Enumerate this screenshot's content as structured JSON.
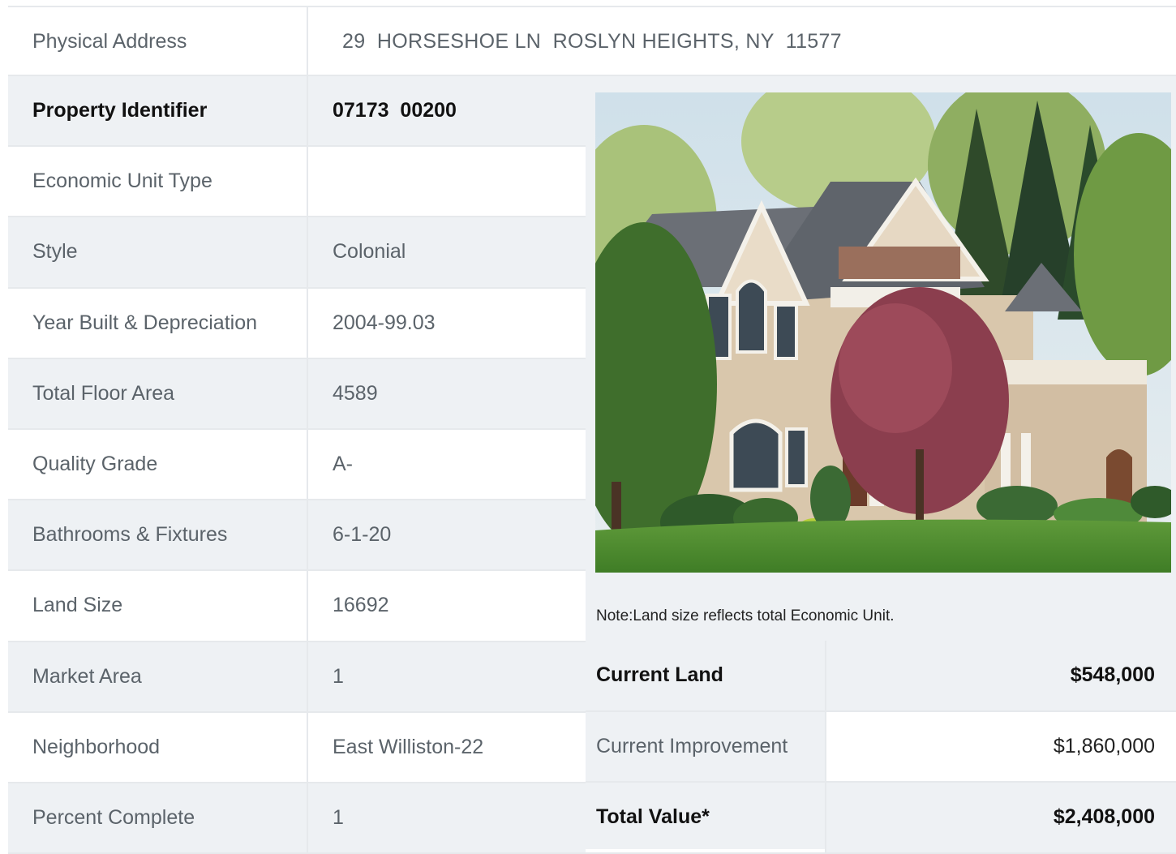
{
  "address": {
    "label": "Physical Address",
    "value": "29  HORSESHOE LN  ROSLYN HEIGHTS, NY  11577"
  },
  "details": [
    {
      "label": "Property Identifier",
      "value": "07173  00200"
    },
    {
      "label": "Economic Unit Type",
      "value": ""
    },
    {
      "label": "Style",
      "value": "Colonial"
    },
    {
      "label": "Year Built & Depreciation",
      "value": "2004-99.03"
    },
    {
      "label": "Total Floor Area",
      "value": "4589"
    },
    {
      "label": "Quality Grade",
      "value": "A-"
    },
    {
      "label": "Bathrooms & Fixtures",
      "value": "6-1-20"
    },
    {
      "label": "Land Size",
      "value": "16692"
    },
    {
      "label": "Market Area",
      "value": "1"
    },
    {
      "label": "Neighborhood",
      "value": "East Williston-22"
    },
    {
      "label": "Percent Complete",
      "value": "1"
    }
  ],
  "note": "Note:Land size reflects total Economic Unit.",
  "valuation": [
    {
      "label": "Current Land",
      "value": "$548,000"
    },
    {
      "label": "Current Improvement",
      "value": "$1,860,000"
    },
    {
      "label": "Total Value*",
      "value": "$2,408,000"
    }
  ],
  "colors": {
    "stripe": "#eef1f4",
    "border": "#e6e9ec",
    "text": "#5b636a"
  }
}
